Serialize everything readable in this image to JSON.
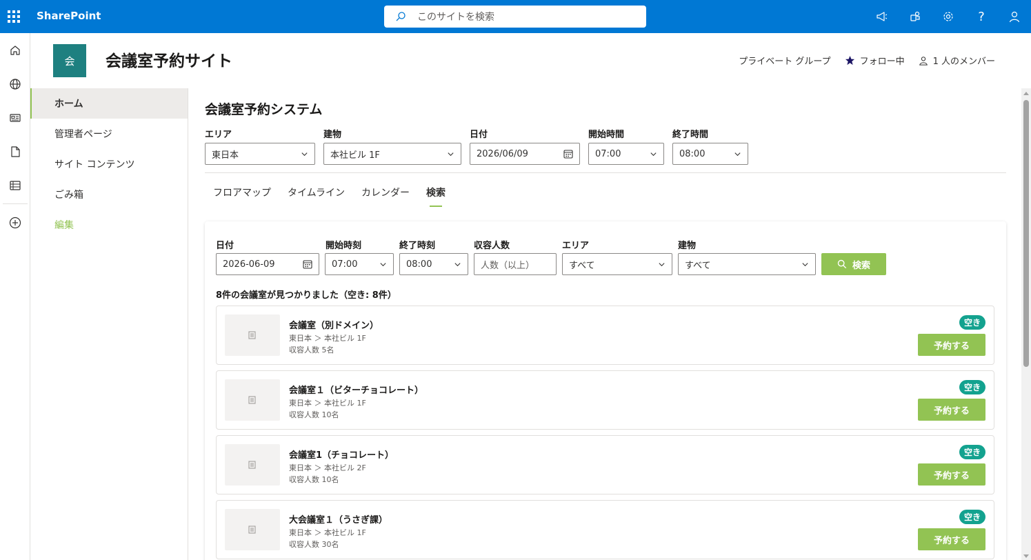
{
  "suite": {
    "brand": "SharePoint",
    "search_placeholder": "このサイトを検索",
    "icons": [
      "waffle-icon",
      "search-icon",
      "megaphone-icon",
      "teams-icon",
      "gear-icon",
      "help-icon",
      "person-icon"
    ],
    "help_glyph": "?"
  },
  "apprail": {
    "icons": [
      "home-icon",
      "globe-icon",
      "news-icon",
      "file-icon",
      "list-icon",
      "add-icon"
    ]
  },
  "site": {
    "logo_text": "会",
    "title": "会議室予約サイト",
    "privacy": "プライベート グループ",
    "follow": "フォロー中",
    "members": "1 人のメンバー"
  },
  "leftnav": {
    "items": [
      {
        "label": "ホーム"
      },
      {
        "label": "管理者ページ"
      },
      {
        "label": "サイト コンテンツ"
      },
      {
        "label": "ごみ箱"
      },
      {
        "label": "編集"
      }
    ]
  },
  "main": {
    "heading": "会議室予約システム",
    "filters": {
      "area_label": "エリア",
      "area_value": "東日本",
      "building_label": "建物",
      "building_value": "本社ビル 1F",
      "date_label": "日付",
      "date_value": "2026/06/09",
      "start_label": "開始時間",
      "start_value": "07:00",
      "end_label": "終了時間",
      "end_value": "08:00"
    },
    "tabs": [
      "フロアマップ",
      "タイムライン",
      "カレンダー",
      "検索"
    ],
    "active_tab": "検索",
    "search": {
      "date_label": "日付",
      "date_value": "2026-06-09",
      "start_label": "開始時刻",
      "start_value": "07:00",
      "end_label": "終了時刻",
      "end_value": "08:00",
      "capacity_label": "収容人数",
      "capacity_placeholder": "人数（以上）",
      "area_label": "エリア",
      "area_value": "すべて",
      "building_label": "建物",
      "building_value": "すべて",
      "button_label": "検索"
    },
    "result_count": "8件の会議室が見つかりました（空き: 8件）",
    "rooms": [
      {
        "name": "会議室（別ドメイン）",
        "location": "東日本 ＞ 本社ビル 1F",
        "capacity": "収容人数 5名",
        "status": "空き",
        "action": "予約する"
      },
      {
        "name": "会議室１（ビターチョコレート）",
        "location": "東日本 ＞ 本社ビル 1F",
        "capacity": "収容人数 10名",
        "status": "空き",
        "action": "予約する"
      },
      {
        "name": "会議室1（チョコレート）",
        "location": "東日本 ＞ 本社ビル 2F",
        "capacity": "収容人数 10名",
        "status": "空き",
        "action": "予約する"
      },
      {
        "name": "大会議室１（うさぎ課）",
        "location": "東日本 ＞ 本社ビル 1F",
        "capacity": "収容人数 30名",
        "status": "空き",
        "action": "予約する"
      }
    ]
  },
  "colors": {
    "suite_blue": "#0078d4",
    "accent_green": "#92c353",
    "badge_teal": "#13a28f",
    "logo_teal": "#1e8080"
  }
}
